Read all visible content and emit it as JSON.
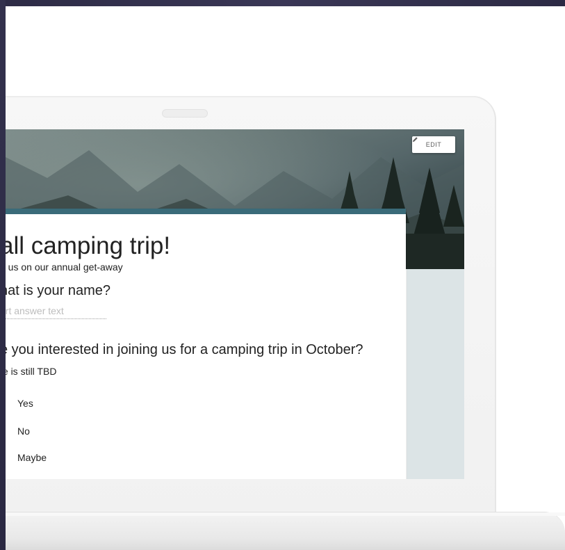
{
  "header": {
    "edit_label": "EDIT"
  },
  "form": {
    "title": "all camping trip!",
    "description": "n us on our annual get-away",
    "questions": [
      {
        "title": "hat is your name?",
        "placeholder": "ort answer text"
      },
      {
        "title": "e you interested in joining us for a camping trip in October?",
        "description": "te is still TBD",
        "options": [
          "Yes",
          "No",
          "Maybe"
        ]
      }
    ]
  },
  "colors": {
    "accent": "#3a6b79",
    "side_panel": "#dce4e6",
    "frame": "#2d2b45"
  },
  "icons": {
    "edit": "pencil-icon"
  }
}
